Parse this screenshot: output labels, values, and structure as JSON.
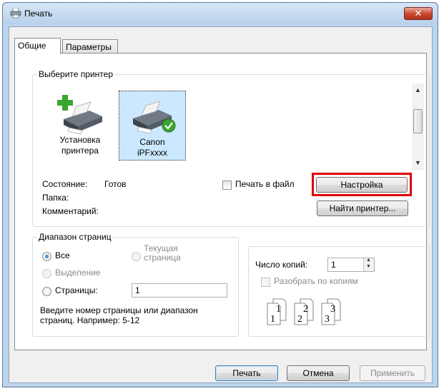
{
  "window": {
    "title": "Печать",
    "close_label": "✕"
  },
  "tabs": [
    {
      "label": "Общие",
      "active": true
    },
    {
      "label": "Параметры",
      "active": false
    }
  ],
  "printer_group": {
    "legend": "Выберите принтер",
    "printers": [
      {
        "label_line1": "Установка",
        "label_line2": "принтера",
        "icon": "add-printer-icon",
        "selected": false
      },
      {
        "label_line1": "Canon",
        "label_line2": "iPFxxxx",
        "icon": "default-printer-icon",
        "selected": true
      }
    ],
    "status_label": "Состояние:",
    "status_value": "Готов",
    "folder_label": "Папка:",
    "comment_label": "Комментарий:",
    "print_to_file_label": "Печать в файл",
    "print_to_file_checked": false,
    "setup_button": "Настройка",
    "find_printer_button": "Найти принтер..."
  },
  "range_group": {
    "legend": "Диапазон страниц",
    "option_all": "Все",
    "option_current_line1": "Текущая",
    "option_current_line2": "страница",
    "option_selection": "Выделение",
    "option_pages": "Страницы:",
    "pages_value": "1",
    "selected_option": "Все",
    "hint_line1": "Введите номер страницы или диапазон",
    "hint_line2": "страниц.  Например: 5-12"
  },
  "copies_group": {
    "copies_label": "Число копий:",
    "copies_value": "1",
    "collate_label": "Разобрать по копиям",
    "collate_checked": false,
    "collate_icon_pairs": [
      "1",
      "1",
      "2",
      "2",
      "3",
      "3"
    ]
  },
  "footer": {
    "print_button": "Печать",
    "cancel_button": "Отмена",
    "apply_button": "Применить"
  },
  "colors": {
    "highlight_box": "#e00000",
    "selection_bg": "#cce8ff",
    "title_bar": "#c4daf0"
  }
}
